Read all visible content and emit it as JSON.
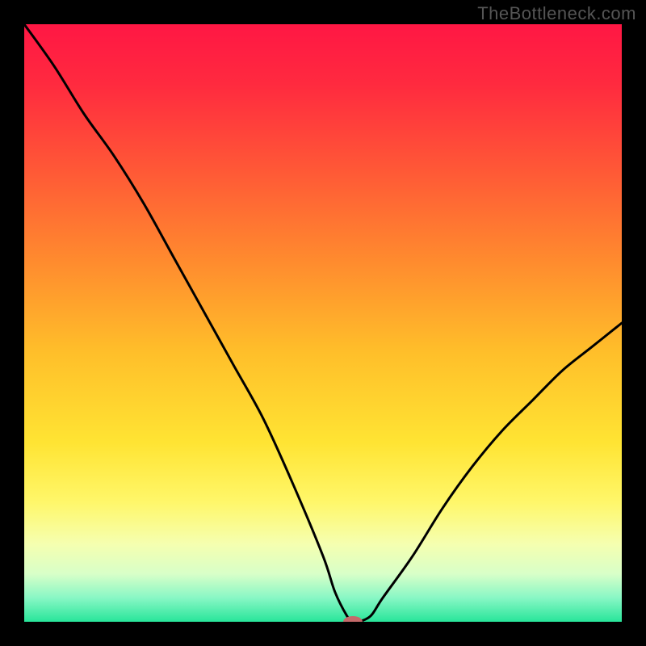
{
  "watermark": "TheBottleneck.com",
  "chart_data": {
    "type": "line",
    "title": "",
    "xlabel": "",
    "ylabel": "",
    "xlim": [
      0,
      100
    ],
    "ylim": [
      0,
      100
    ],
    "x": [
      0,
      5,
      10,
      15,
      20,
      25,
      30,
      35,
      40,
      45,
      50,
      52,
      54,
      55,
      56,
      58,
      60,
      65,
      70,
      75,
      80,
      85,
      90,
      95,
      100
    ],
    "values": [
      100,
      93,
      85,
      78,
      70,
      61,
      52,
      43,
      34,
      23,
      11,
      5,
      1,
      0,
      0,
      1,
      4,
      11,
      19,
      26,
      32,
      37,
      42,
      46,
      50
    ],
    "gradient_stops": [
      {
        "offset": 0.0,
        "color": "#ff1744"
      },
      {
        "offset": 0.1,
        "color": "#ff2a3f"
      },
      {
        "offset": 0.25,
        "color": "#ff5a36"
      },
      {
        "offset": 0.4,
        "color": "#ff8c2e"
      },
      {
        "offset": 0.55,
        "color": "#ffbf2a"
      },
      {
        "offset": 0.7,
        "color": "#ffe433"
      },
      {
        "offset": 0.8,
        "color": "#fff76a"
      },
      {
        "offset": 0.87,
        "color": "#f5ffb0"
      },
      {
        "offset": 0.92,
        "color": "#d8ffc8"
      },
      {
        "offset": 0.96,
        "color": "#88f7c5"
      },
      {
        "offset": 1.0,
        "color": "#28e59a"
      }
    ],
    "marker": {
      "x": 55,
      "y": 0,
      "color": "#c46a6a",
      "rx": 12,
      "ry": 7
    },
    "line_color": "#000000",
    "line_width": 3
  }
}
